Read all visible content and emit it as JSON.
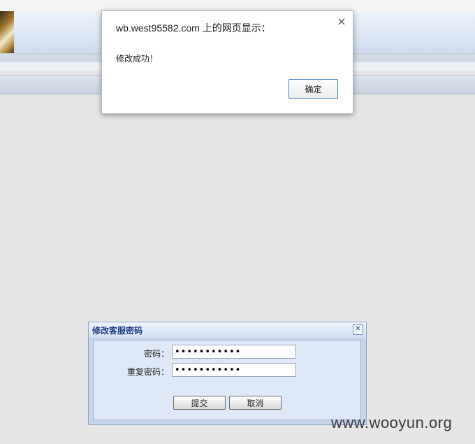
{
  "alert": {
    "title": "wb.west95582.com 上的网页显示：",
    "close_glyph": "×",
    "message": "修改成功！",
    "ok_label": "确定"
  },
  "dialog": {
    "title": "修改客服密码",
    "close_glyph": "✕",
    "password_label": "密码：",
    "password_value": "•••••••••••",
    "confirm_label": "重复密码：",
    "confirm_value": "•••••••••••",
    "submit_label": "提交",
    "cancel_label": "取消"
  },
  "watermark": "www.wooyun.org",
  "colors": {
    "dialog_title": "#1e3f86",
    "alert_ok_border": "#4a7fc8",
    "page_background": "#e6e6e6"
  }
}
